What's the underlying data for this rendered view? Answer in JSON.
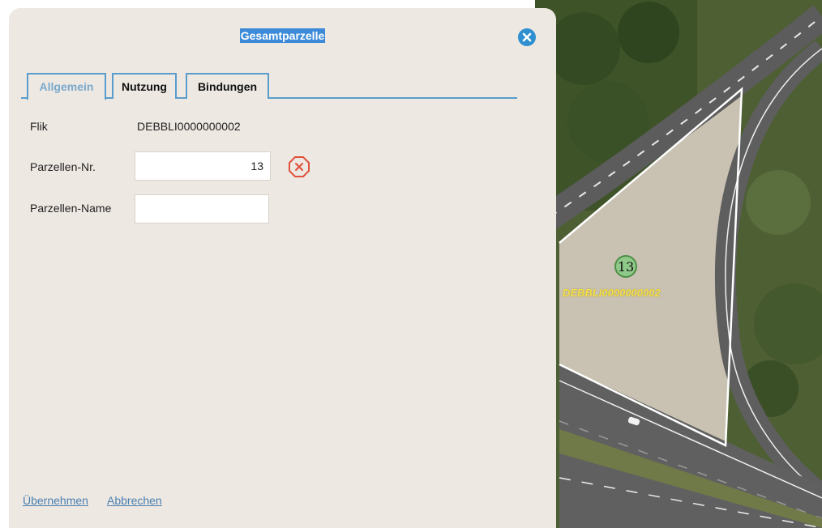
{
  "dialog": {
    "title": "Gesamtparzelle",
    "close_icon": "close-icon"
  },
  "tabs": [
    {
      "label": "Allgemein",
      "active": true
    },
    {
      "label": "Nutzung",
      "active": false
    },
    {
      "label": "Bindungen",
      "active": false
    }
  ],
  "form": {
    "flik_label": "Flik",
    "flik_value": "DEBBLI0000000002",
    "parzellen_nr_label": "Parzellen-Nr.",
    "parzellen_nr_value": "13",
    "parzellen_name_label": "Parzellen-Name",
    "parzellen_name_value": "",
    "clear_icon": "clear-icon"
  },
  "footer": {
    "apply_label": "Übernehmen",
    "cancel_label": "Abbrechen"
  },
  "map": {
    "parcel_number": "13",
    "parcel_flik": "DEBBLI0000000002"
  },
  "colors": {
    "dialog_bg": "#ede8e2",
    "accent": "#3d8bd8",
    "tab_border": "#5a9ccb",
    "link": "#4a7fb0",
    "clear_icon": "#e0503a",
    "flik_label_map": "#f5e04a"
  }
}
